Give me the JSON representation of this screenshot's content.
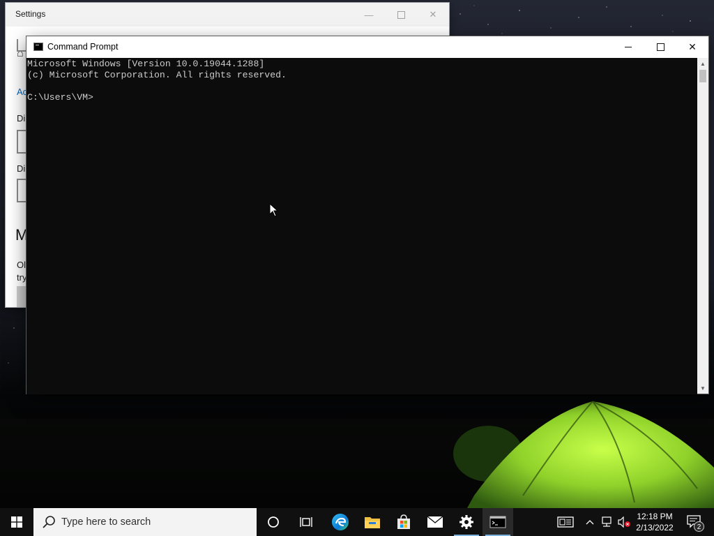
{
  "settings_window": {
    "title": "Settings",
    "partial_texts": {
      "link_fragment": "Ac",
      "label1_fragment": "Di",
      "label2_fragment": "Di",
      "heading_fragment": "M",
      "para_line1_fragment": "Ol",
      "para_line2_fragment": "try"
    }
  },
  "cmd_window": {
    "title": "Command Prompt",
    "lines": [
      "Microsoft Windows [Version 10.0.19044.1288]",
      "(c) Microsoft Corporation. All rights reserved.",
      "",
      "C:\\Users\\VM>"
    ]
  },
  "taskbar": {
    "search_placeholder": "Type here to search",
    "pinned": [
      "start-icon",
      "cortana-icon",
      "task-view-icon",
      "edge-icon",
      "file-explorer-icon",
      "microsoft-store-icon",
      "mail-icon",
      "settings-icon",
      "command-prompt-icon"
    ],
    "tray": {
      "time": "12:18 PM",
      "date": "2/13/2022",
      "notification_count": "2"
    }
  },
  "colors": {
    "console_bg": "#0c0c0c",
    "console_text": "#cccccc",
    "taskbar_bg": "#101010",
    "active_underline": "#7fb3e0",
    "tent_green": "#a6e63a"
  }
}
